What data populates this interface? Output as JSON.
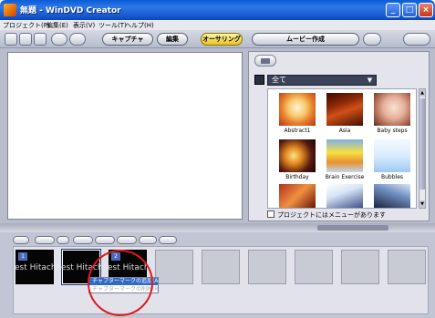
{
  "window": {
    "title": "無題 - WinDVD Creator",
    "controls": [
      "_",
      "□",
      "×"
    ]
  },
  "menu": [
    "プロジェクト(P)",
    "編集(E)",
    "表示(V)",
    "ツール(T)",
    "ヘルプ(H)"
  ],
  "toolbar": {
    "steps": [
      "キャプチャ",
      "編集",
      "オーサリング",
      "ムービー作成"
    ],
    "active_step": "オーサリング"
  },
  "menu_panel": {
    "category": "全て",
    "templates": [
      "Abstract1",
      "Asia",
      "Baby steps",
      "Birthday",
      "Brain Exercise",
      "Bubbles"
    ],
    "project_menu_label": "プロジェクトにはメニューがあります"
  },
  "chapter_bar": {
    "thumbnail_text": "est Hitachi",
    "context_menu": {
      "items": [
        "チャプターマークの追加(A)",
        "チャプターマークの削除(R)"
      ]
    }
  },
  "colors": {
    "title_bar": "#1f66de",
    "active_step": "#f0c828",
    "highlight": "#316ac5",
    "annotation_circle": "#e01818"
  }
}
